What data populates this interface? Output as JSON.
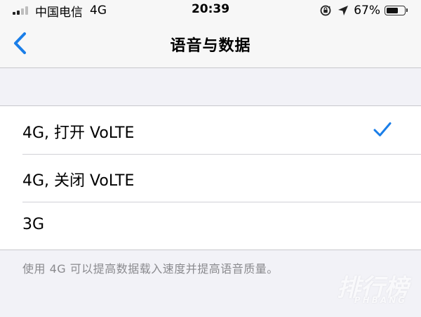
{
  "status_bar": {
    "carrier": "中国电信",
    "network": "4G",
    "time": "20:39",
    "battery_percent": "67%",
    "battery_level": 0.67
  },
  "nav": {
    "title": "语音与数据"
  },
  "options": [
    {
      "label": "4G, 打开 VoLTE",
      "selected": true
    },
    {
      "label": "4G, 关闭 VoLTE",
      "selected": false
    },
    {
      "label": "3G",
      "selected": false
    }
  ],
  "footer": {
    "note": "使用 4G 可以提高数据载入速度并提高语音质量。"
  },
  "watermark": {
    "main": "排行榜",
    "sub": "PHBANG"
  },
  "colors": {
    "accent": "#1a7ee8",
    "background": "#f2f2f7",
    "secondary_text": "#8a8a8e"
  }
}
